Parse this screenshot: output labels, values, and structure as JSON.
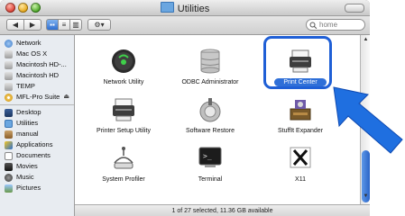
{
  "window": {
    "title": "Utilities"
  },
  "toolbar": {
    "back": "◀",
    "forward": "▶",
    "view_icon": "▪▪",
    "view_list": "≡",
    "view_column": "▥",
    "action": "⚙▾",
    "search_placeholder": "home"
  },
  "sidebar": {
    "devices": [
      {
        "label": "Network",
        "icon": "network-icon"
      },
      {
        "label": "Mac OS X",
        "icon": "disk-icon"
      },
      {
        "label": "Macintosh HD-...",
        "icon": "disk-icon"
      },
      {
        "label": "Macintosh HD",
        "icon": "disk-icon"
      },
      {
        "label": "TEMP",
        "icon": "disk-icon"
      },
      {
        "label": "MFL-Pro Suite",
        "icon": "cd-icon",
        "eject": "⏏"
      }
    ],
    "places": [
      {
        "label": "Desktop",
        "icon": "desktop-icon"
      },
      {
        "label": "Utilities",
        "icon": "utilities-folder-icon"
      },
      {
        "label": "manual",
        "icon": "home-icon"
      },
      {
        "label": "Applications",
        "icon": "applications-icon"
      },
      {
        "label": "Documents",
        "icon": "documents-icon"
      },
      {
        "label": "Movies",
        "icon": "movies-icon"
      },
      {
        "label": "Music",
        "icon": "music-icon"
      },
      {
        "label": "Pictures",
        "icon": "pictures-icon"
      }
    ]
  },
  "files": [
    {
      "label": "Network Utility",
      "icon": "network-utility-icon",
      "selected": false
    },
    {
      "label": "ODBC Administrator",
      "icon": "odbc-icon",
      "selected": false
    },
    {
      "label": "Print Center",
      "icon": "print-center-icon",
      "selected": true
    },
    {
      "label": "Printer Setup Utility",
      "icon": "printer-setup-icon",
      "selected": false
    },
    {
      "label": "Software Restore",
      "icon": "software-restore-icon",
      "selected": false
    },
    {
      "label": "StuffIt Expander",
      "icon": "stuffit-icon",
      "selected": false
    },
    {
      "label": "System Profiler",
      "icon": "system-profiler-icon",
      "selected": false
    },
    {
      "label": "Terminal",
      "icon": "terminal-icon",
      "selected": false
    },
    {
      "label": "X11",
      "icon": "x11-icon",
      "selected": false
    }
  ],
  "status": "1 of 27 selected, 11.36 GB available",
  "colors": {
    "accent": "#1f5fd6",
    "pointer": "#1f6fe0"
  }
}
